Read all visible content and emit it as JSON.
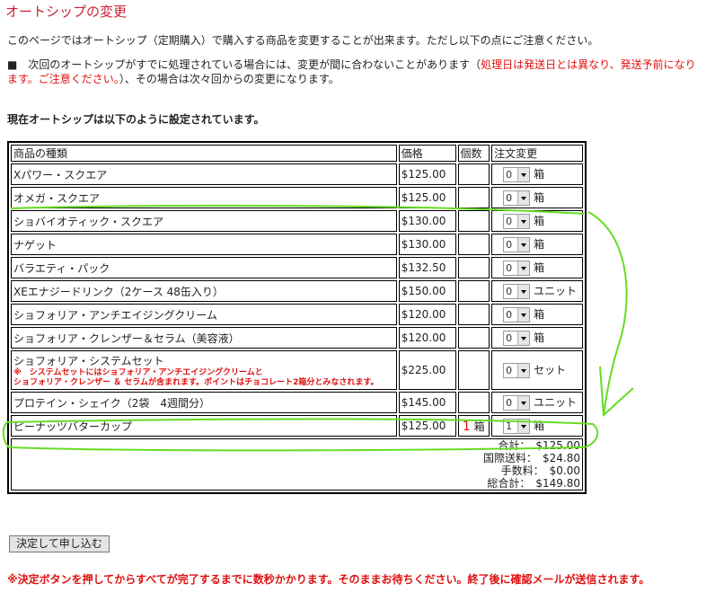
{
  "page": {
    "title": "オートシップの変更",
    "intro": "このページではオートシップ（定期購入）で購入する商品を変更することが出来ます。ただし以下の点にご注意ください。",
    "notice_prefix": "■　次回のオートシップがすでに処理されている場合には、変更が間に合わないことがあります（",
    "notice_red": "処理日は発送日とは異なり、発送予前になります。ご注意ください。",
    "notice_suffix": "）、その場合は次々回からの変更になります。",
    "subheading": "現在オートシップは以下のように設定されています。"
  },
  "table": {
    "headers": {
      "name": "商品の種類",
      "price": "価格",
      "qty": "個数",
      "change": "注文変更"
    },
    "rows": [
      {
        "name": "Xパワー・スクエア",
        "price": "$125.00",
        "qty": "",
        "sel": "0",
        "unit": "箱"
      },
      {
        "name": "オメガ・スクエア",
        "price": "$125.00",
        "qty": "",
        "sel": "0",
        "unit": "箱"
      },
      {
        "name": "ショバイオティック・スクエア",
        "price": "$130.00",
        "qty": "",
        "sel": "0",
        "unit": "箱"
      },
      {
        "name": "ナゲット",
        "price": "$130.00",
        "qty": "",
        "sel": "0",
        "unit": "箱"
      },
      {
        "name": "バラエティ・パック",
        "price": "$132.50",
        "qty": "",
        "sel": "0",
        "unit": "箱"
      },
      {
        "name": "XEエナジードリンク（2ケース 48缶入り）",
        "price": "$150.00",
        "qty": "",
        "sel": "0",
        "unit": "ユニット"
      },
      {
        "name": "ショフォリア・アンチエイジングクリーム",
        "price": "$120.00",
        "qty": "",
        "sel": "0",
        "unit": "箱"
      },
      {
        "name": "ショフォリア・クレンザー＆セラム（美容液）",
        "price": "$120.00",
        "qty": "",
        "sel": "0",
        "unit": "箱"
      },
      {
        "name": "ショフォリア・システムセット",
        "note1": "※　システムセットにはショフォリア・アンチエイジングクリームと",
        "note2": "ショフォリア・クレンザー ＆ セラムが含まれます。ポイントはチョコレート2箱分とみなされます。",
        "price": "$225.00",
        "qty": "",
        "sel": "0",
        "unit": "セット"
      },
      {
        "name": "プロテイン・シェイク（2袋　4週間分）",
        "price": "$145.00",
        "qty": "",
        "sel": "0",
        "unit": "ユニット"
      },
      {
        "name": "ピーナッツバターカップ",
        "price": "$125.00",
        "qty": "1",
        "qty_unit": "箱",
        "sel": "1",
        "unit": "箱"
      }
    ],
    "totals": {
      "subtotal": "合計：　$125.00",
      "shipping": "国際送料：　$24.80",
      "fee": "手数料：　$0.00",
      "grand": "総合計：　$149.80"
    }
  },
  "buttons": {
    "submit": "決定して申し込む"
  },
  "footer": "※決定ボタンを押してからすべてが完了するまでに数秒かかります。そのままお待ちください。終了後に確認メールが送信されます。",
  "colors": {
    "title": "#cc2233",
    "warning": "#e01010",
    "annotation": "#66dd22"
  }
}
